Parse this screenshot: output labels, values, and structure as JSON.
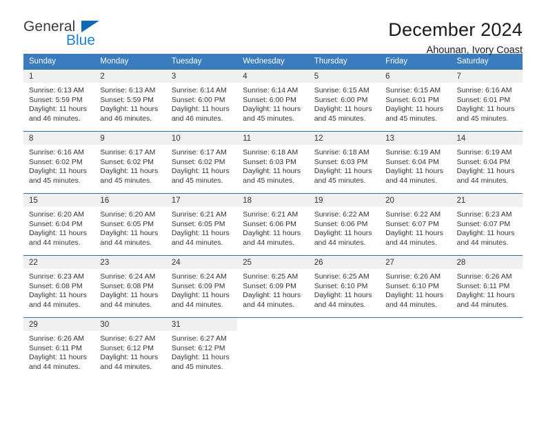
{
  "brand": {
    "name_top": "General",
    "name_bottom": "Blue",
    "accent_color": "#1069b4",
    "blue_text_color": "#1f7fd0"
  },
  "header": {
    "title": "December 2024",
    "subtitle": "Ahounan, Ivory Coast"
  },
  "theme": {
    "header_row_bg": "#3a7cbe",
    "week_divider": "#2f6ea5",
    "daynum_bg": "#f0f0f0",
    "text": "#333333"
  },
  "weekday_headers": [
    "Sunday",
    "Monday",
    "Tuesday",
    "Wednesday",
    "Thursday",
    "Friday",
    "Saturday"
  ],
  "weeks": [
    [
      {
        "day": "1",
        "sunrise": "Sunrise: 6:13 AM",
        "sunset": "Sunset: 5:59 PM",
        "daylight_1": "Daylight: 11 hours",
        "daylight_2": "and 46 minutes."
      },
      {
        "day": "2",
        "sunrise": "Sunrise: 6:13 AM",
        "sunset": "Sunset: 5:59 PM",
        "daylight_1": "Daylight: 11 hours",
        "daylight_2": "and 46 minutes."
      },
      {
        "day": "3",
        "sunrise": "Sunrise: 6:14 AM",
        "sunset": "Sunset: 6:00 PM",
        "daylight_1": "Daylight: 11 hours",
        "daylight_2": "and 46 minutes."
      },
      {
        "day": "4",
        "sunrise": "Sunrise: 6:14 AM",
        "sunset": "Sunset: 6:00 PM",
        "daylight_1": "Daylight: 11 hours",
        "daylight_2": "and 45 minutes."
      },
      {
        "day": "5",
        "sunrise": "Sunrise: 6:15 AM",
        "sunset": "Sunset: 6:00 PM",
        "daylight_1": "Daylight: 11 hours",
        "daylight_2": "and 45 minutes."
      },
      {
        "day": "6",
        "sunrise": "Sunrise: 6:15 AM",
        "sunset": "Sunset: 6:01 PM",
        "daylight_1": "Daylight: 11 hours",
        "daylight_2": "and 45 minutes."
      },
      {
        "day": "7",
        "sunrise": "Sunrise: 6:16 AM",
        "sunset": "Sunset: 6:01 PM",
        "daylight_1": "Daylight: 11 hours",
        "daylight_2": "and 45 minutes."
      }
    ],
    [
      {
        "day": "8",
        "sunrise": "Sunrise: 6:16 AM",
        "sunset": "Sunset: 6:02 PM",
        "daylight_1": "Daylight: 11 hours",
        "daylight_2": "and 45 minutes."
      },
      {
        "day": "9",
        "sunrise": "Sunrise: 6:17 AM",
        "sunset": "Sunset: 6:02 PM",
        "daylight_1": "Daylight: 11 hours",
        "daylight_2": "and 45 minutes."
      },
      {
        "day": "10",
        "sunrise": "Sunrise: 6:17 AM",
        "sunset": "Sunset: 6:02 PM",
        "daylight_1": "Daylight: 11 hours",
        "daylight_2": "and 45 minutes."
      },
      {
        "day": "11",
        "sunrise": "Sunrise: 6:18 AM",
        "sunset": "Sunset: 6:03 PM",
        "daylight_1": "Daylight: 11 hours",
        "daylight_2": "and 45 minutes."
      },
      {
        "day": "12",
        "sunrise": "Sunrise: 6:18 AM",
        "sunset": "Sunset: 6:03 PM",
        "daylight_1": "Daylight: 11 hours",
        "daylight_2": "and 45 minutes."
      },
      {
        "day": "13",
        "sunrise": "Sunrise: 6:19 AM",
        "sunset": "Sunset: 6:04 PM",
        "daylight_1": "Daylight: 11 hours",
        "daylight_2": "and 44 minutes."
      },
      {
        "day": "14",
        "sunrise": "Sunrise: 6:19 AM",
        "sunset": "Sunset: 6:04 PM",
        "daylight_1": "Daylight: 11 hours",
        "daylight_2": "and 44 minutes."
      }
    ],
    [
      {
        "day": "15",
        "sunrise": "Sunrise: 6:20 AM",
        "sunset": "Sunset: 6:04 PM",
        "daylight_1": "Daylight: 11 hours",
        "daylight_2": "and 44 minutes."
      },
      {
        "day": "16",
        "sunrise": "Sunrise: 6:20 AM",
        "sunset": "Sunset: 6:05 PM",
        "daylight_1": "Daylight: 11 hours",
        "daylight_2": "and 44 minutes."
      },
      {
        "day": "17",
        "sunrise": "Sunrise: 6:21 AM",
        "sunset": "Sunset: 6:05 PM",
        "daylight_1": "Daylight: 11 hours",
        "daylight_2": "and 44 minutes."
      },
      {
        "day": "18",
        "sunrise": "Sunrise: 6:21 AM",
        "sunset": "Sunset: 6:06 PM",
        "daylight_1": "Daylight: 11 hours",
        "daylight_2": "and 44 minutes."
      },
      {
        "day": "19",
        "sunrise": "Sunrise: 6:22 AM",
        "sunset": "Sunset: 6:06 PM",
        "daylight_1": "Daylight: 11 hours",
        "daylight_2": "and 44 minutes."
      },
      {
        "day": "20",
        "sunrise": "Sunrise: 6:22 AM",
        "sunset": "Sunset: 6:07 PM",
        "daylight_1": "Daylight: 11 hours",
        "daylight_2": "and 44 minutes."
      },
      {
        "day": "21",
        "sunrise": "Sunrise: 6:23 AM",
        "sunset": "Sunset: 6:07 PM",
        "daylight_1": "Daylight: 11 hours",
        "daylight_2": "and 44 minutes."
      }
    ],
    [
      {
        "day": "22",
        "sunrise": "Sunrise: 6:23 AM",
        "sunset": "Sunset: 6:08 PM",
        "daylight_1": "Daylight: 11 hours",
        "daylight_2": "and 44 minutes."
      },
      {
        "day": "23",
        "sunrise": "Sunrise: 6:24 AM",
        "sunset": "Sunset: 6:08 PM",
        "daylight_1": "Daylight: 11 hours",
        "daylight_2": "and 44 minutes."
      },
      {
        "day": "24",
        "sunrise": "Sunrise: 6:24 AM",
        "sunset": "Sunset: 6:09 PM",
        "daylight_1": "Daylight: 11 hours",
        "daylight_2": "and 44 minutes."
      },
      {
        "day": "25",
        "sunrise": "Sunrise: 6:25 AM",
        "sunset": "Sunset: 6:09 PM",
        "daylight_1": "Daylight: 11 hours",
        "daylight_2": "and 44 minutes."
      },
      {
        "day": "26",
        "sunrise": "Sunrise: 6:25 AM",
        "sunset": "Sunset: 6:10 PM",
        "daylight_1": "Daylight: 11 hours",
        "daylight_2": "and 44 minutes."
      },
      {
        "day": "27",
        "sunrise": "Sunrise: 6:26 AM",
        "sunset": "Sunset: 6:10 PM",
        "daylight_1": "Daylight: 11 hours",
        "daylight_2": "and 44 minutes."
      },
      {
        "day": "28",
        "sunrise": "Sunrise: 6:26 AM",
        "sunset": "Sunset: 6:11 PM",
        "daylight_1": "Daylight: 11 hours",
        "daylight_2": "and 44 minutes."
      }
    ],
    [
      {
        "day": "29",
        "sunrise": "Sunrise: 6:26 AM",
        "sunset": "Sunset: 6:11 PM",
        "daylight_1": "Daylight: 11 hours",
        "daylight_2": "and 44 minutes."
      },
      {
        "day": "30",
        "sunrise": "Sunrise: 6:27 AM",
        "sunset": "Sunset: 6:12 PM",
        "daylight_1": "Daylight: 11 hours",
        "daylight_2": "and 44 minutes."
      },
      {
        "day": "31",
        "sunrise": "Sunrise: 6:27 AM",
        "sunset": "Sunset: 6:12 PM",
        "daylight_1": "Daylight: 11 hours",
        "daylight_2": "and 45 minutes."
      },
      {
        "day": "",
        "sunrise": "",
        "sunset": "",
        "daylight_1": "",
        "daylight_2": ""
      },
      {
        "day": "",
        "sunrise": "",
        "sunset": "",
        "daylight_1": "",
        "daylight_2": ""
      },
      {
        "day": "",
        "sunrise": "",
        "sunset": "",
        "daylight_1": "",
        "daylight_2": ""
      },
      {
        "day": "",
        "sunrise": "",
        "sunset": "",
        "daylight_1": "",
        "daylight_2": ""
      }
    ]
  ]
}
